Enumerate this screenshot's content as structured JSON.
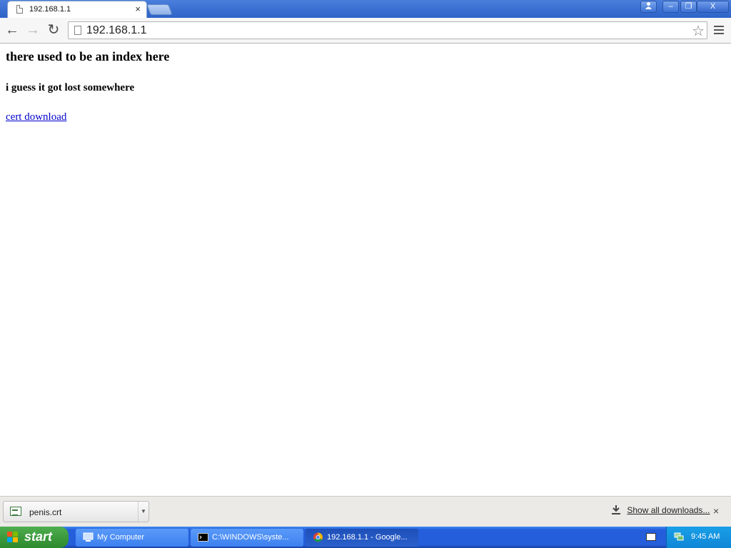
{
  "browser": {
    "tab": {
      "title": "192.168.1.1",
      "close": "×"
    },
    "window_buttons": {
      "minimize": "–",
      "restore": "❐",
      "close": "X"
    },
    "nav": {
      "back": "←",
      "forward": "→",
      "reload": "↻"
    },
    "omnibox": {
      "url": "192.168.1.1",
      "bookmark": "☆"
    }
  },
  "page": {
    "heading": "there used to be an index here",
    "subheading": "i guess it got lost somewhere",
    "link": "cert download"
  },
  "download_shelf": {
    "item_name": "penis.crt",
    "dropdown": "▼",
    "show_all": "Show all downloads...",
    "close": "×"
  },
  "taskbar": {
    "start_label": "start",
    "tasks": [
      {
        "label": "My Computer"
      },
      {
        "label": "C:\\WINDOWS\\syste..."
      },
      {
        "label": "192.168.1.1 - Google..."
      }
    ],
    "clock": "9:45 AM"
  }
}
